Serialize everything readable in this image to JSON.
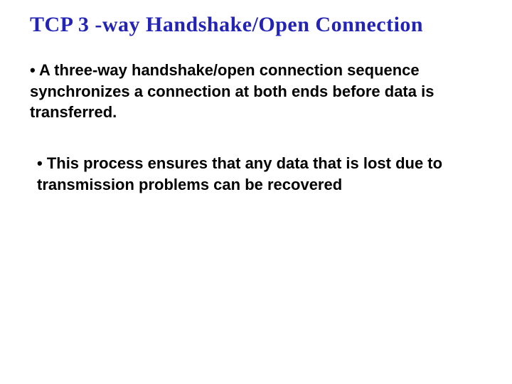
{
  "slide": {
    "title": "TCP 3 -way Handshake/Open Connection",
    "bullets": [
      "• A three-way handshake/open connection sequence synchronizes a connection at both ends before data is transferred.",
      "• This process ensures that any data that is lost due to transmission problems can be recovered"
    ]
  }
}
